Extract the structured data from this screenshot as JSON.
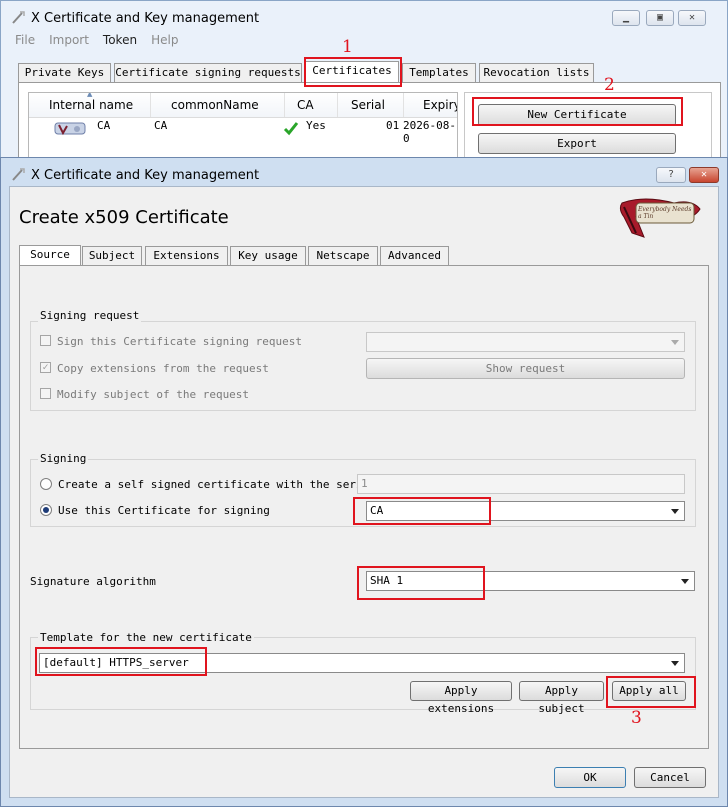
{
  "main_window": {
    "title": "X Certificate and Key management",
    "menu": [
      "File",
      "Import",
      "Token",
      "Help"
    ],
    "tabs": [
      "Private Keys",
      "Certificate signing requests",
      "Certificates",
      "Templates",
      "Revocation lists"
    ],
    "active_tab": "Certificates",
    "table": {
      "columns": [
        "Internal name",
        "commonName",
        "CA",
        "Serial",
        "Expiry"
      ],
      "rows": [
        {
          "internal_name": "CA",
          "common_name": "CA",
          "ca": "Yes",
          "serial": "01",
          "expiry": "2026-08-0"
        }
      ]
    },
    "buttons": {
      "new_certificate": "New Certificate",
      "export": "Export"
    }
  },
  "dialog": {
    "title": "X Certificate and Key management",
    "help_label": "?",
    "heading": "Create x509 Certificate",
    "logo_text": "Everybody Needs a Tin",
    "tabs": [
      "Source",
      "Subject",
      "Extensions",
      "Key usage",
      "Netscape",
      "Advanced"
    ],
    "active_tab": "Source",
    "signing_request": {
      "label": "Signing request",
      "sign_csr": "Sign this Certificate signing request",
      "copy_extensions": "Copy extensions from the request",
      "modify_subject": "Modify subject of the request",
      "show_request": "Show request",
      "copy_extensions_checked": true
    },
    "signing": {
      "label": "Signing",
      "self_signed": "Create a self signed certificate with the serial",
      "serial_value": "1",
      "use_cert": "Use this Certificate for signing",
      "signing_cert": "CA"
    },
    "signature_algorithm": {
      "label": "Signature algorithm",
      "value": "SHA 1"
    },
    "template": {
      "label": "Template for the new certificate",
      "value": "[default] HTTPS_server",
      "apply_extensions": "Apply extensions",
      "apply_subject": "Apply subject",
      "apply_all": "Apply all"
    },
    "ok": "OK",
    "cancel": "Cancel"
  },
  "annotations": [
    "1",
    "2",
    "3"
  ],
  "colors": {
    "highlight": "#e0141e",
    "check": "#2aa52a"
  }
}
